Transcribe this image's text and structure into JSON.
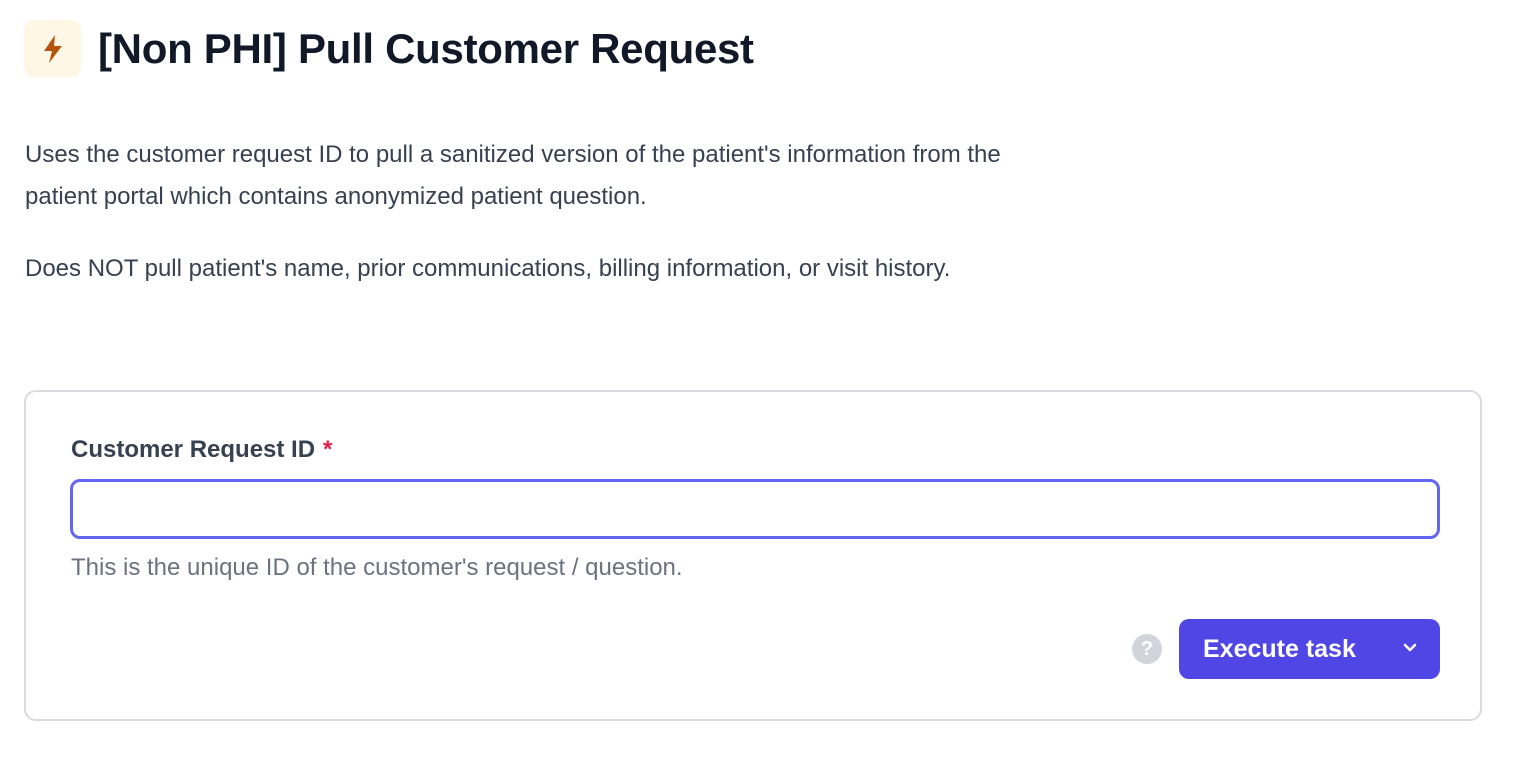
{
  "header": {
    "icon": "lightning-bolt-icon",
    "icon_color": "#b45309",
    "icon_bg": "#fef7e6",
    "title": "[Non PHI] Pull Customer Request"
  },
  "description": {
    "paragraph_1": "Uses the customer request ID to pull a sanitized version of the patient's information from the patient portal which contains anonymized patient question.",
    "paragraph_2": "Does NOT pull patient's name, prior communications, billing information, or visit history."
  },
  "form": {
    "field_label": "Customer Request ID",
    "required_marker": "*",
    "input_value": "",
    "help_text": "This is the unique ID of the customer's request / question.",
    "help_icon": "question-mark-icon",
    "help_icon_glyph": "?",
    "execute_label": "Execute task",
    "dropdown_icon": "chevron-down-icon",
    "accent_color": "#4f46e5",
    "focus_color": "#6366f1"
  }
}
